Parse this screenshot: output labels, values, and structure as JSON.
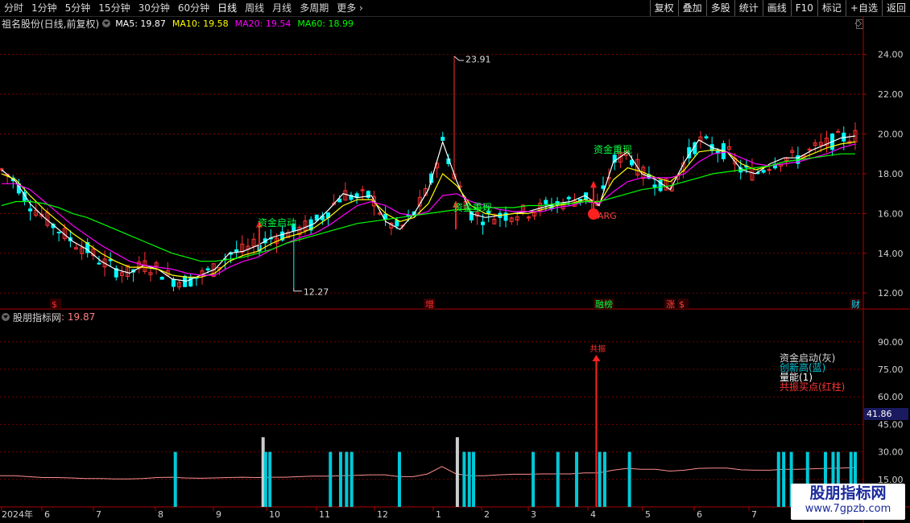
{
  "toolbar": {
    "periods": [
      "分时",
      "1分钟",
      "5分钟",
      "15分钟",
      "30分钟",
      "60分钟",
      "日线",
      "周线",
      "月线",
      "多周期",
      "更多"
    ],
    "active_period": "日线",
    "right_buttons": [
      "复权",
      "叠加",
      "多股",
      "统计",
      "画线",
      "F10",
      "标记",
      "+自选",
      "返回"
    ]
  },
  "main_legend": {
    "stock_name": "祖名股份(日线,前复权)",
    "ma": [
      {
        "label": "MA5: 19.87",
        "color": "#ffffff"
      },
      {
        "label": "MA10: 19.58",
        "color": "#ffff00"
      },
      {
        "label": "MA20: 19.54",
        "color": "#ff00ff"
      },
      {
        "label": "MA60: 18.99",
        "color": "#00ff00"
      }
    ]
  },
  "indicator_legend": {
    "name": "股朋指标网",
    "value": ": 19.87"
  },
  "indicator_notes": [
    {
      "text": "资金启动(灰)",
      "color": "#d8d8d8"
    },
    {
      "text": "创新高(蓝)",
      "color": "#00c8d8"
    },
    {
      "text": "量能(1)",
      "color": "#ffffff"
    },
    {
      "text": "共振买点(红柱)",
      "color": "#ff3333"
    }
  ],
  "readout_value": "41.86",
  "watermark": {
    "line1": "股朋指标网",
    "line2": "www.7gpzb.com"
  },
  "colors": {
    "up": "#ff3232",
    "down": "#00ffff",
    "ma5": "#ffffff",
    "ma10": "#ffff00",
    "ma20": "#ff00ff",
    "ma60": "#00ff00",
    "axis": "#b00000",
    "bar_blue": "#00c8d8",
    "bar_gray": "#cccccc",
    "bar_red": "#ff2020"
  },
  "chart_data": [
    {
      "type": "candlestick",
      "title": "祖名股份(日线,前复权)",
      "y_ticks": [
        12.0,
        14.0,
        16.0,
        18.0,
        20.0,
        22.0,
        24.0
      ],
      "ylim": [
        11.2,
        25.2
      ],
      "x_labels": [
        "2024年",
        "6",
        "7",
        "8",
        "9",
        "10",
        "11",
        "12",
        "1",
        "2",
        "3",
        "4",
        "5",
        "6",
        "7"
      ],
      "price_annotations": [
        {
          "label": "23.91",
          "type": "high"
        },
        {
          "label": "12.27",
          "type": "low"
        }
      ],
      "signal_labels": [
        "资金启动",
        "资金重现",
        "资金重现",
        "ARG"
      ],
      "event_markers": [
        "$",
        "增",
        "融榜",
        "涨",
        "$",
        "财"
      ],
      "series": [
        {
          "name": "MA5",
          "values": [
            18.2,
            17.6,
            16.5,
            15.8,
            15.2,
            14.6,
            14.2,
            13.6,
            13.2,
            13.0,
            13.4,
            13.2,
            12.7,
            12.6,
            12.9,
            13.2,
            14.0,
            14.1,
            14.4,
            14.8,
            15.0,
            15.2,
            15.5,
            16.2,
            17.0,
            16.8,
            16.9,
            15.6,
            15.2,
            16.0,
            17.2,
            19.6,
            17.6,
            16.0,
            15.8,
            15.9,
            16.0,
            16.1,
            16.3,
            16.5,
            16.6,
            16.9,
            16.4,
            18.6,
            19.1,
            18.0,
            17.7,
            17.2,
            18.6,
            19.7,
            19.3,
            19.1,
            18.2,
            18.0,
            18.5,
            18.8,
            18.8,
            19.2,
            19.5,
            19.8,
            19.9
          ]
        },
        {
          "name": "MA10",
          "values": [
            18.0,
            17.7,
            16.9,
            16.2,
            15.6,
            15.0,
            14.5,
            14.0,
            13.6,
            13.3,
            13.3,
            13.2,
            12.9,
            12.8,
            12.8,
            13.0,
            13.6,
            13.9,
            14.1,
            14.5,
            14.8,
            15.0,
            15.3,
            15.8,
            16.4,
            16.7,
            16.7,
            16.0,
            15.6,
            15.8,
            16.5,
            18.0,
            17.4,
            16.4,
            16.0,
            15.9,
            16.0,
            16.0,
            16.2,
            16.4,
            16.5,
            16.7,
            16.5,
            17.7,
            18.3,
            18.1,
            17.8,
            17.6,
            18.2,
            19.1,
            19.2,
            19.1,
            18.5,
            18.2,
            18.4,
            18.6,
            18.7,
            19.0,
            19.3,
            19.5,
            19.6
          ]
        },
        {
          "name": "MA20",
          "values": [
            17.5,
            17.5,
            17.2,
            16.6,
            16.0,
            15.4,
            14.9,
            14.4,
            14.0,
            13.6,
            13.4,
            13.3,
            13.2,
            13.0,
            12.9,
            12.9,
            13.3,
            13.6,
            13.8,
            14.2,
            14.5,
            14.8,
            15.0,
            15.4,
            15.9,
            16.4,
            16.6,
            16.4,
            16.0,
            15.9,
            16.1,
            16.9,
            17.0,
            16.6,
            16.4,
            16.2,
            16.1,
            16.1,
            16.1,
            16.3,
            16.4,
            16.6,
            16.5,
            17.1,
            17.6,
            17.8,
            17.8,
            17.8,
            18.0,
            18.6,
            19.0,
            19.1,
            18.8,
            18.5,
            18.4,
            18.5,
            18.6,
            18.8,
            19.0,
            19.3,
            19.5
          ]
        },
        {
          "name": "MA60",
          "values": [
            16.4,
            16.6,
            16.6,
            16.5,
            16.3,
            16.0,
            15.8,
            15.5,
            15.2,
            14.9,
            14.6,
            14.3,
            14.0,
            13.8,
            13.6,
            13.6,
            13.7,
            13.8,
            14.0,
            14.2,
            14.5,
            14.7,
            14.9,
            15.1,
            15.3,
            15.5,
            15.6,
            15.7,
            15.8,
            15.9,
            16.0,
            16.1,
            16.2,
            16.2,
            16.3,
            16.3,
            16.3,
            16.4,
            16.4,
            16.5,
            16.5,
            16.6,
            16.6,
            16.8,
            17.0,
            17.2,
            17.3,
            17.4,
            17.6,
            17.8,
            18.0,
            18.1,
            18.2,
            18.3,
            18.4,
            18.6,
            18.7,
            18.8,
            18.9,
            19.0,
            19.0
          ]
        }
      ]
    },
    {
      "type": "bar",
      "title": "股朋指标网",
      "y_ticks": [
        15.0,
        30.0,
        45.0,
        60.0,
        75.0,
        90.0
      ],
      "ylim": [
        0,
        100
      ],
      "line_series": {
        "name": "股朋指标网",
        "values": [
          17,
          17,
          16.5,
          16,
          16,
          15.8,
          15.5,
          15.5,
          15.2,
          15.2,
          15.5,
          16,
          16.2,
          15.8,
          15.6,
          15.8,
          16,
          16.2,
          16,
          16.2,
          16.2,
          16.5,
          16.8,
          16.8,
          17,
          17.2,
          17.5,
          17.5,
          16.5,
          16.5,
          18,
          22,
          18,
          17,
          17,
          17.5,
          17.8,
          17.8,
          18,
          18,
          18,
          18.5,
          18.5,
          20,
          21,
          20.5,
          20.5,
          19.5,
          20,
          21,
          21.2,
          21.2,
          20.2,
          20,
          20,
          20.5,
          20.5,
          20.8,
          21,
          21.2,
          21.5
        ]
      },
      "bars": [
        {
          "pos": 0.202,
          "value": 30,
          "color": "blue"
        },
        {
          "pos": 0.305,
          "value": 38,
          "color": "gray"
        },
        {
          "pos": 0.308,
          "value": 30,
          "color": "blue"
        },
        {
          "pos": 0.313,
          "value": 30,
          "color": "blue"
        },
        {
          "pos": 0.384,
          "value": 30,
          "color": "blue"
        },
        {
          "pos": 0.396,
          "value": 30,
          "color": "blue"
        },
        {
          "pos": 0.403,
          "value": 30,
          "color": "blue"
        },
        {
          "pos": 0.409,
          "value": 30,
          "color": "blue"
        },
        {
          "pos": 0.465,
          "value": 30,
          "color": "blue"
        },
        {
          "pos": 0.533,
          "value": 38,
          "color": "gray"
        },
        {
          "pos": 0.541,
          "value": 30,
          "color": "blue"
        },
        {
          "pos": 0.547,
          "value": 30,
          "color": "blue"
        },
        {
          "pos": 0.552,
          "value": 30,
          "color": "blue"
        },
        {
          "pos": 0.622,
          "value": 30,
          "color": "blue"
        },
        {
          "pos": 0.651,
          "value": 30,
          "color": "blue"
        },
        {
          "pos": 0.673,
          "value": 30,
          "color": "blue"
        },
        {
          "pos": 0.697,
          "value": 82,
          "color": "red"
        },
        {
          "pos": 0.7,
          "value": 30,
          "color": "blue"
        },
        {
          "pos": 0.706,
          "value": 30,
          "color": "blue"
        },
        {
          "pos": 0.735,
          "value": 30,
          "color": "blue"
        },
        {
          "pos": 0.91,
          "value": 30,
          "color": "blue"
        },
        {
          "pos": 0.916,
          "value": 30,
          "color": "blue"
        },
        {
          "pos": 0.925,
          "value": 30,
          "color": "blue"
        },
        {
          "pos": 0.944,
          "value": 30,
          "color": "blue"
        },
        {
          "pos": 0.965,
          "value": 30,
          "color": "blue"
        },
        {
          "pos": 0.974,
          "value": 30,
          "color": "blue"
        },
        {
          "pos": 0.98,
          "value": 30,
          "color": "blue"
        },
        {
          "pos": 0.995,
          "value": 30,
          "color": "blue"
        },
        {
          "pos": 1.0,
          "value": 30,
          "color": "blue"
        }
      ],
      "signal_label": "共振"
    }
  ]
}
